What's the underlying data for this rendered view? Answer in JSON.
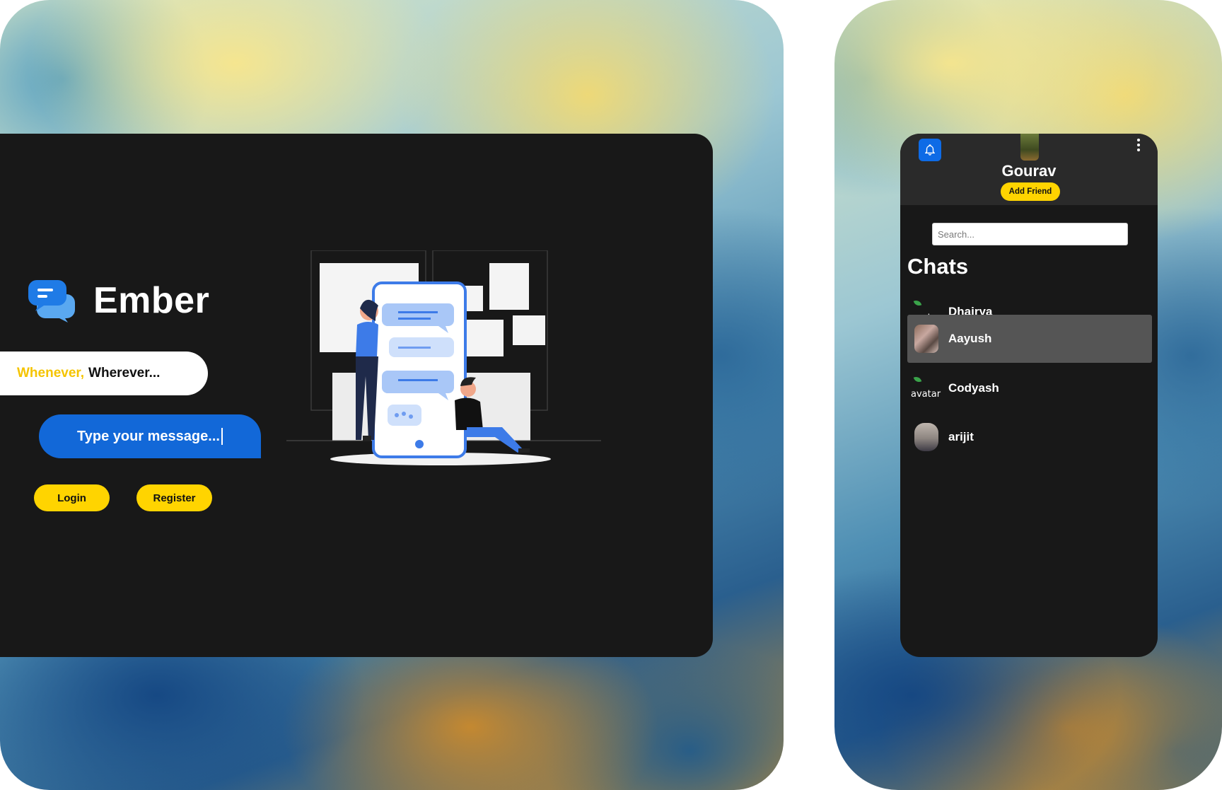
{
  "login": {
    "brand_name": "Ember",
    "tagline_accent": "Whenever,",
    "tagline_rest": "Wherever...",
    "message_input_value": "Type your message...",
    "login_label": "Login",
    "register_label": "Register"
  },
  "phone": {
    "profile_name": "Gourav",
    "add_friend_label": "Add Friend",
    "search_placeholder": "Search...",
    "chats_title": "Chats",
    "chats": [
      {
        "name": "Dhairya",
        "avatar_alt": "avatar"
      },
      {
        "name": "Aayush"
      },
      {
        "name": "Codyash",
        "avatar_alt": "avatar"
      },
      {
        "name": "arijit"
      }
    ]
  },
  "colors": {
    "accent_yellow": "#ffd400",
    "accent_blue": "#1268d8",
    "panel_dark": "#181818",
    "header_dark": "#2a2a2a",
    "active_row": "#555555"
  },
  "icons": [
    "chat-bubbles-logo-icon",
    "bell-icon",
    "more-vertical-icon",
    "messaging-illustration"
  ]
}
